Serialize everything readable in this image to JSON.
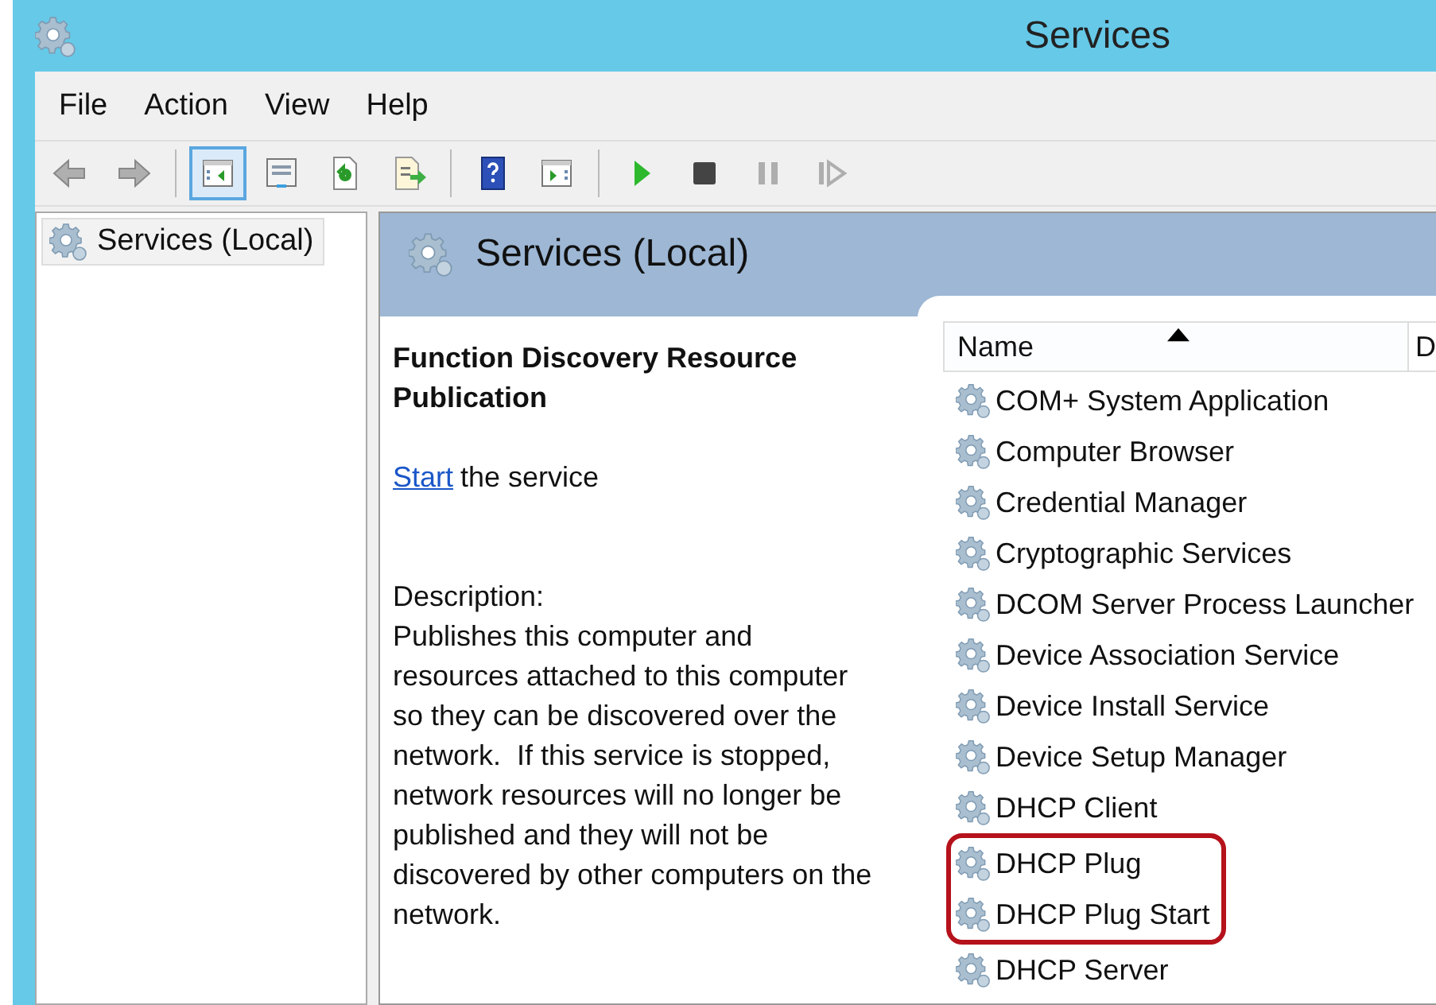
{
  "window": {
    "title": "Services"
  },
  "menu": [
    "File",
    "Action",
    "View",
    "Help"
  ],
  "toolbar": [
    {
      "kind": "back",
      "disabled": true,
      "pressed": false
    },
    {
      "kind": "forward",
      "disabled": true,
      "pressed": false
    },
    {
      "kind": "separator"
    },
    {
      "kind": "console-tree",
      "disabled": false,
      "pressed": true
    },
    {
      "kind": "properties",
      "disabled": false,
      "pressed": false
    },
    {
      "kind": "refresh",
      "disabled": false,
      "pressed": false
    },
    {
      "kind": "export",
      "disabled": false,
      "pressed": false
    },
    {
      "kind": "separator"
    },
    {
      "kind": "help",
      "disabled": false,
      "pressed": false
    },
    {
      "kind": "action-pane",
      "disabled": false,
      "pressed": false
    },
    {
      "kind": "separator"
    },
    {
      "kind": "play",
      "disabled": false,
      "pressed": false
    },
    {
      "kind": "stop",
      "disabled": false,
      "pressed": false
    },
    {
      "kind": "pause",
      "disabled": true,
      "pressed": false
    },
    {
      "kind": "resume",
      "disabled": true,
      "pressed": false
    }
  ],
  "tree": {
    "items": [
      {
        "label": "Services (Local)",
        "selected": true
      }
    ]
  },
  "details": {
    "heading": "Services (Local)",
    "service_name": "Function Discovery Resource Publication",
    "action": {
      "link": "Start",
      "text": "the service"
    },
    "description_label": "Description:",
    "description": "Publishes this computer and resources attached to this computer so they can be discovered over the network.  If this service is stopped, network resources will no longer be published and they will not be discovered by other computers on the network."
  },
  "list": {
    "columns": [
      {
        "label": "Name",
        "sorted": true
      },
      {
        "label": "D",
        "sorted": false
      }
    ],
    "rows": [
      {
        "name": "COM+ System Application",
        "highlighted": false
      },
      {
        "name": "Computer Browser",
        "highlighted": false
      },
      {
        "name": "Credential Manager",
        "highlighted": false
      },
      {
        "name": "Cryptographic Services",
        "highlighted": false
      },
      {
        "name": "DCOM Server Process Launcher",
        "highlighted": false
      },
      {
        "name": "Device Association Service",
        "highlighted": false
      },
      {
        "name": "Device Install Service",
        "highlighted": false
      },
      {
        "name": "Device Setup Manager",
        "highlighted": false
      },
      {
        "name": "DHCP Client",
        "highlighted": false
      },
      {
        "name": "DHCP Plug",
        "highlighted": true
      },
      {
        "name": "DHCP Plug Start",
        "highlighted": true
      },
      {
        "name": "DHCP Server",
        "highlighted": false
      }
    ]
  }
}
